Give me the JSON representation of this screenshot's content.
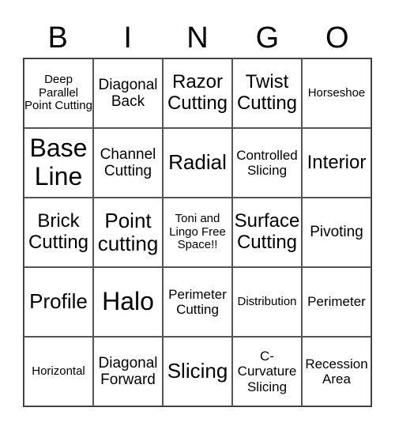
{
  "header": [
    "B",
    "I",
    "N",
    "G",
    "O"
  ],
  "cells": [
    "Deep Parallel Point Cutting",
    "Diagonal Back",
    "Razor Cutting",
    "Twist Cutting",
    "Horseshoe",
    "Base Line",
    "Channel Cutting",
    "Radial",
    "Controlled Slicing",
    "Interior",
    "Brick Cutting",
    "Point cutting",
    "Toni and Lingo Free Space!!",
    "Surface Cutting",
    "Pivoting",
    "Profile",
    "Halo",
    "Perimeter Cutting",
    "Distribution",
    "Perimeter",
    "Horizontal",
    "Diagonal Forward",
    "Slicing",
    "C-Curvature Slicing",
    "Recession Area"
  ]
}
